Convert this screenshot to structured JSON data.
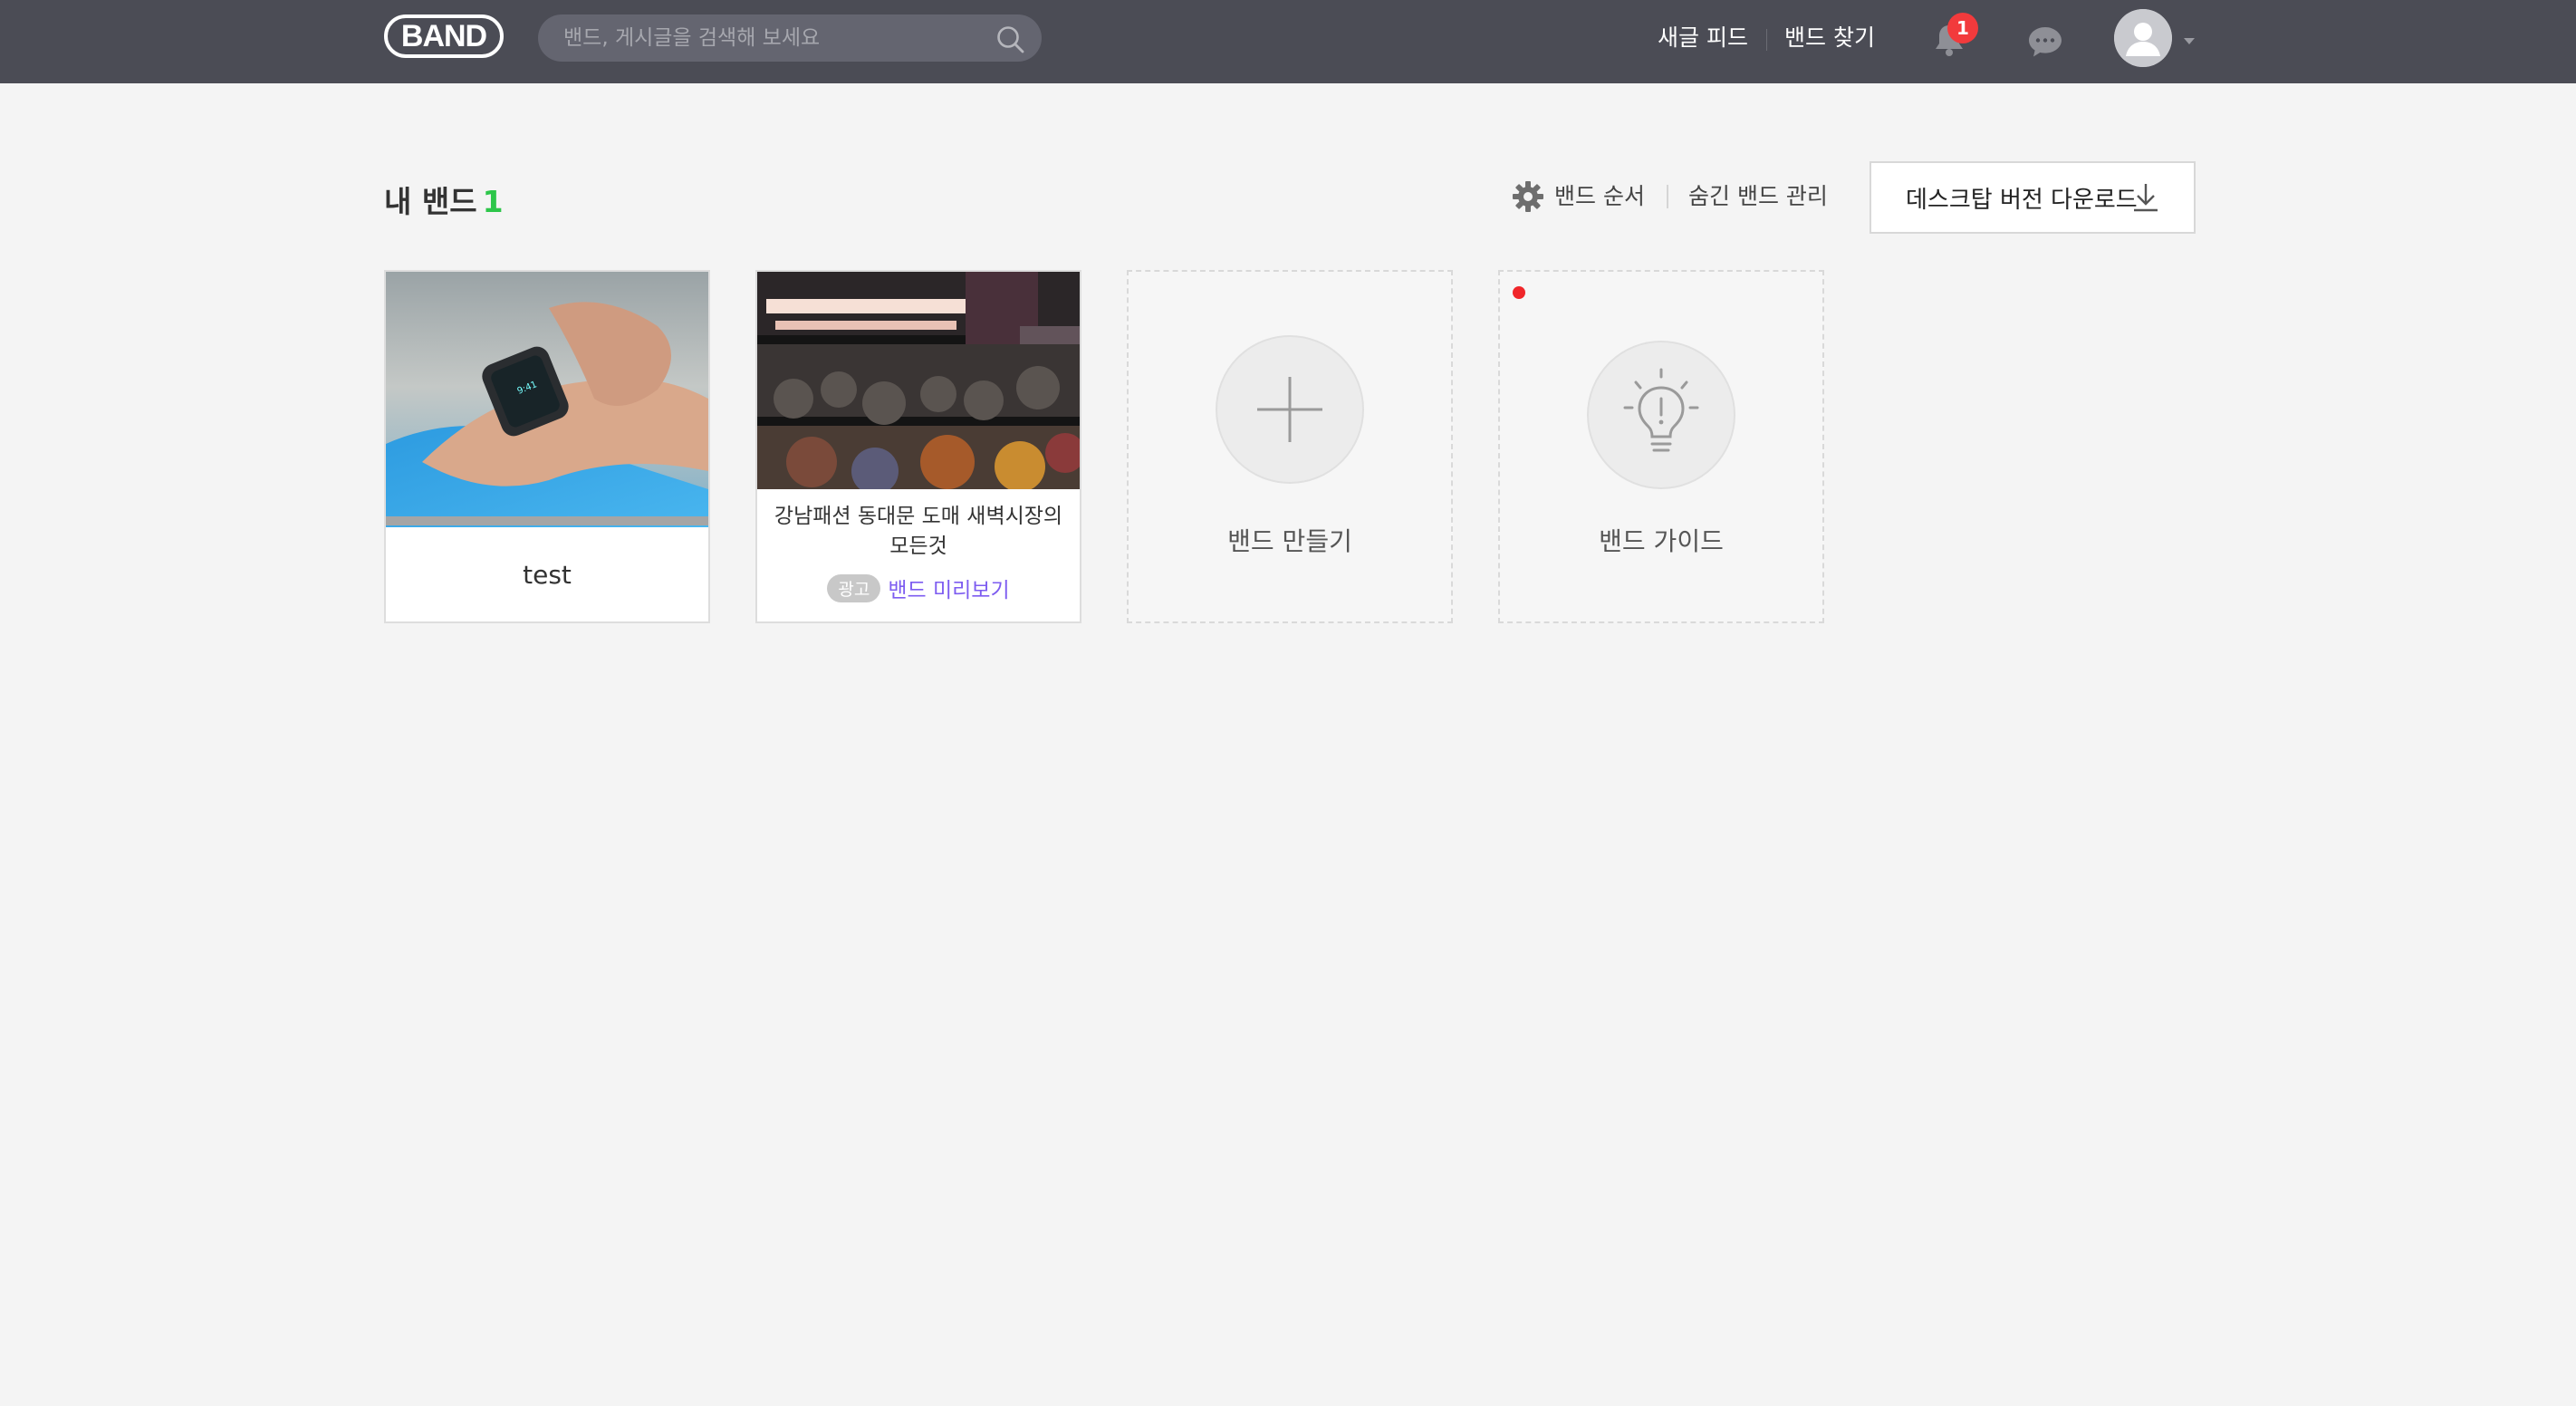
{
  "header": {
    "logo": "BAND",
    "search_placeholder": "밴드, 게시글을 검색해 보세요",
    "nav": [
      "새글 피드",
      "밴드 찾기"
    ],
    "notification_count": "1",
    "icons": [
      "search-icon",
      "bell-icon",
      "chat-icon",
      "avatar-icon",
      "caret-down-icon"
    ]
  },
  "main": {
    "title": "내 밴드",
    "count": "1",
    "order_label": "밴드 순서",
    "hidden_label": "숨긴 밴드 관리",
    "download_label": "데스크탑 버전 다운로드"
  },
  "cards": [
    {
      "name": "test",
      "type": "band"
    },
    {
      "name_line1": "강남패션 동대문 도매 새벽시장의",
      "name_line2": "모든것",
      "ad_badge": "광고",
      "preview_link": "밴드 미리보기",
      "type": "ad"
    },
    {
      "name": "밴드 만들기",
      "type": "create"
    },
    {
      "name": "밴드 가이드",
      "type": "guide"
    }
  ],
  "colors": {
    "header_bg": "#4b4c55",
    "page_bg": "#f4f4f4",
    "count_green": "#2dc64a",
    "badge_red": "#f23a3c",
    "link_purple": "#7d5cf0"
  }
}
